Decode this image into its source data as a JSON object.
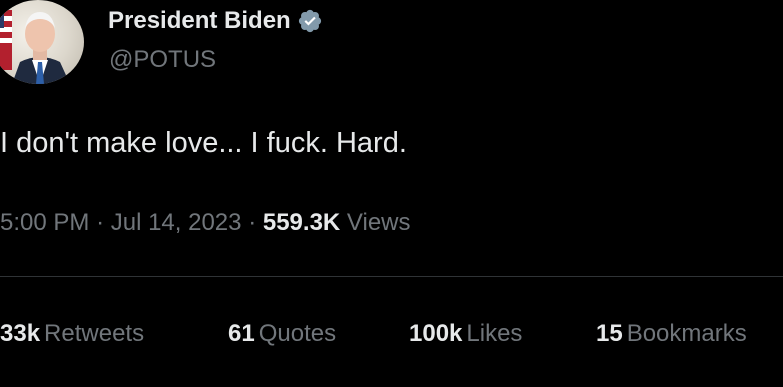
{
  "author": {
    "display_name": "President Biden",
    "handle": "@POTUS",
    "verified": true,
    "verified_color": "#829aab"
  },
  "tweet": {
    "text": "I don't make love... I fuck. Hard."
  },
  "meta": {
    "time": "5:00 PM",
    "separator": "·",
    "date": "Jul 14, 2023",
    "views_count": "559.3K",
    "views_label": "Views"
  },
  "stats": {
    "retweets": {
      "count": "33k",
      "label": "Retweets"
    },
    "quotes": {
      "count": "61",
      "label": "Quotes"
    },
    "likes": {
      "count": "100k",
      "label": "Likes"
    },
    "bookmarks": {
      "count": "15",
      "label": "Bookmarks"
    }
  },
  "colors": {
    "background": "#000000",
    "primary_text": "#e7e9ea",
    "secondary_text": "#71767b",
    "divider": "#2f3336"
  },
  "icons": {
    "verified": "verified-badge-icon",
    "avatar": "profile-avatar"
  }
}
